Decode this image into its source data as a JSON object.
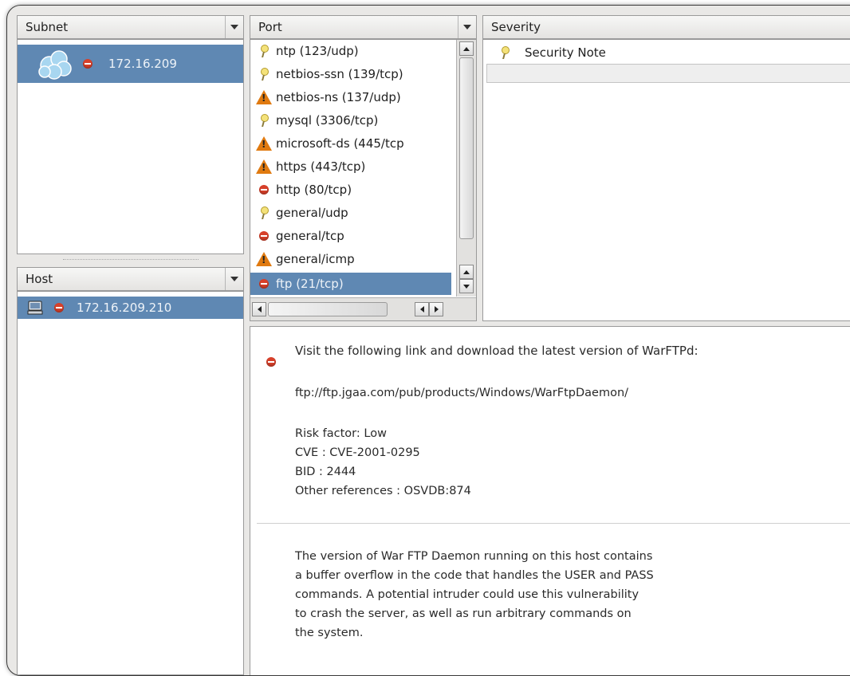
{
  "subnet": {
    "header": "Subnet",
    "items": [
      {
        "label": "172.16.209",
        "icon": "cloud-icon",
        "status": "deny-icon"
      }
    ]
  },
  "host": {
    "header": "Host",
    "items": [
      {
        "label": "172.16.209.210",
        "icon": "computer-icon",
        "status": "deny-icon"
      }
    ]
  },
  "port": {
    "header": "Port",
    "items": [
      {
        "label": "ntp (123/udp)",
        "icon": "note-icon"
      },
      {
        "label": "netbios-ssn (139/tcp)",
        "icon": "note-icon"
      },
      {
        "label": "netbios-ns (137/udp)",
        "icon": "warning-icon"
      },
      {
        "label": "mysql (3306/tcp)",
        "icon": "note-icon"
      },
      {
        "label": "microsoft-ds (445/tcp",
        "icon": "warning-icon"
      },
      {
        "label": "https (443/tcp)",
        "icon": "warning-icon"
      },
      {
        "label": "http (80/tcp)",
        "icon": "deny-icon"
      },
      {
        "label": "general/udp",
        "icon": "note-icon"
      },
      {
        "label": "general/tcp",
        "icon": "deny-icon"
      },
      {
        "label": "general/icmp",
        "icon": "warning-icon"
      },
      {
        "label": "ftp (21/tcp)",
        "icon": "deny-icon",
        "selected": true
      }
    ]
  },
  "severity": {
    "header": "Severity",
    "items": [
      {
        "label": "Security Note",
        "icon": "note-icon"
      }
    ]
  },
  "detail": {
    "block1": {
      "line1": "Visit the following link and download the latest version of WarFTPd:",
      "line2": "ftp://ftp.jgaa.com/pub/products/Windows/WarFtpDaemon/",
      "line3": "Risk factor: Low",
      "line4": "CVE : CVE-2001-0295",
      "line5": "BID : 2444",
      "line6": "Other references : OSVDB:874"
    },
    "block2": {
      "line1": "The version of War FTP Daemon running on this host contains",
      "line2": "a buffer overflow in the code that handles the USER and PASS",
      "line3": "commands. A potential intruder could use this vulnerability",
      "line4": "to crash the server, as well as run arbitrary commands on",
      "line5": "the system."
    }
  },
  "colors": {
    "selection": "#5f88b3",
    "deny": "#d7402a",
    "warning": "#e07a10"
  }
}
